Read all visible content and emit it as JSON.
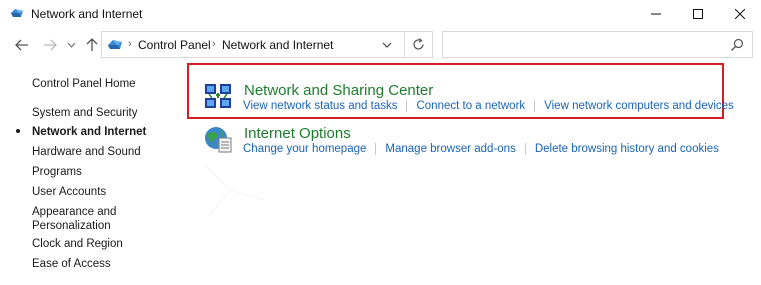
{
  "window": {
    "title": "Network and Internet"
  },
  "address": {
    "crumbs": [
      "Control Panel",
      "Network and Internet"
    ],
    "search_placeholder": ""
  },
  "sidebar": {
    "items": [
      {
        "label": "Control Panel Home",
        "active": false
      },
      {
        "label": "System and Security",
        "active": false
      },
      {
        "label": "Network and Internet",
        "active": true
      },
      {
        "label": "Hardware and Sound",
        "active": false
      },
      {
        "label": "Programs",
        "active": false
      },
      {
        "label": "User Accounts",
        "active": false
      },
      {
        "label": "Appearance and",
        "active": false
      },
      {
        "label": "Personalization",
        "active": false
      },
      {
        "label": "Clock and Region",
        "active": false
      },
      {
        "label": "Ease of Access",
        "active": false
      }
    ]
  },
  "categories": [
    {
      "title": "Network and Sharing Center",
      "icon": "network-sharing-icon",
      "links": [
        "View network status and tasks",
        "Connect to a network",
        "View network computers and devices"
      ]
    },
    {
      "title": "Internet Options",
      "icon": "internet-options-icon",
      "links": [
        "Change your homepage",
        "Manage browser add-ons",
        "Delete browsing history and cookies"
      ]
    }
  ],
  "colors": {
    "category_title": "#1e7d2d",
    "link": "#1a63b8",
    "highlight_border": "#d21f26"
  }
}
